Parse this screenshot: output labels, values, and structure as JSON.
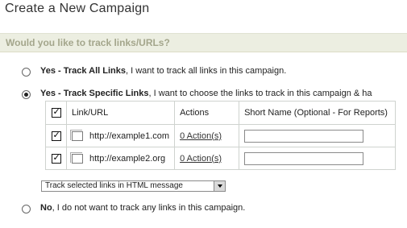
{
  "page": {
    "title": "Create a New Campaign"
  },
  "section": {
    "question": "Would you like to track links/URLs?"
  },
  "options": [
    {
      "bold": "Yes - Track All Links",
      "rest": ", I want to track all links in this campaign.",
      "selected": false
    },
    {
      "bold": "Yes - Track Specific Links",
      "rest": ", I want to choose the links to track in this campaign & ha",
      "selected": true
    },
    {
      "bold": "No",
      "rest": ", I do not want to track any links in this campaign.",
      "selected": false
    }
  ],
  "table": {
    "headers": {
      "link": "Link/URL",
      "actions": "Actions",
      "short_name": "Short Name (Optional - For Reports)"
    },
    "rows": [
      {
        "checked": true,
        "url": "http://example1.com",
        "action": "0 Action(s)",
        "short_name": ""
      },
      {
        "checked": true,
        "url": "http://example2.org",
        "action": "0 Action(s)",
        "short_name": ""
      }
    ]
  },
  "select": {
    "value": "Track selected links in HTML message"
  }
}
